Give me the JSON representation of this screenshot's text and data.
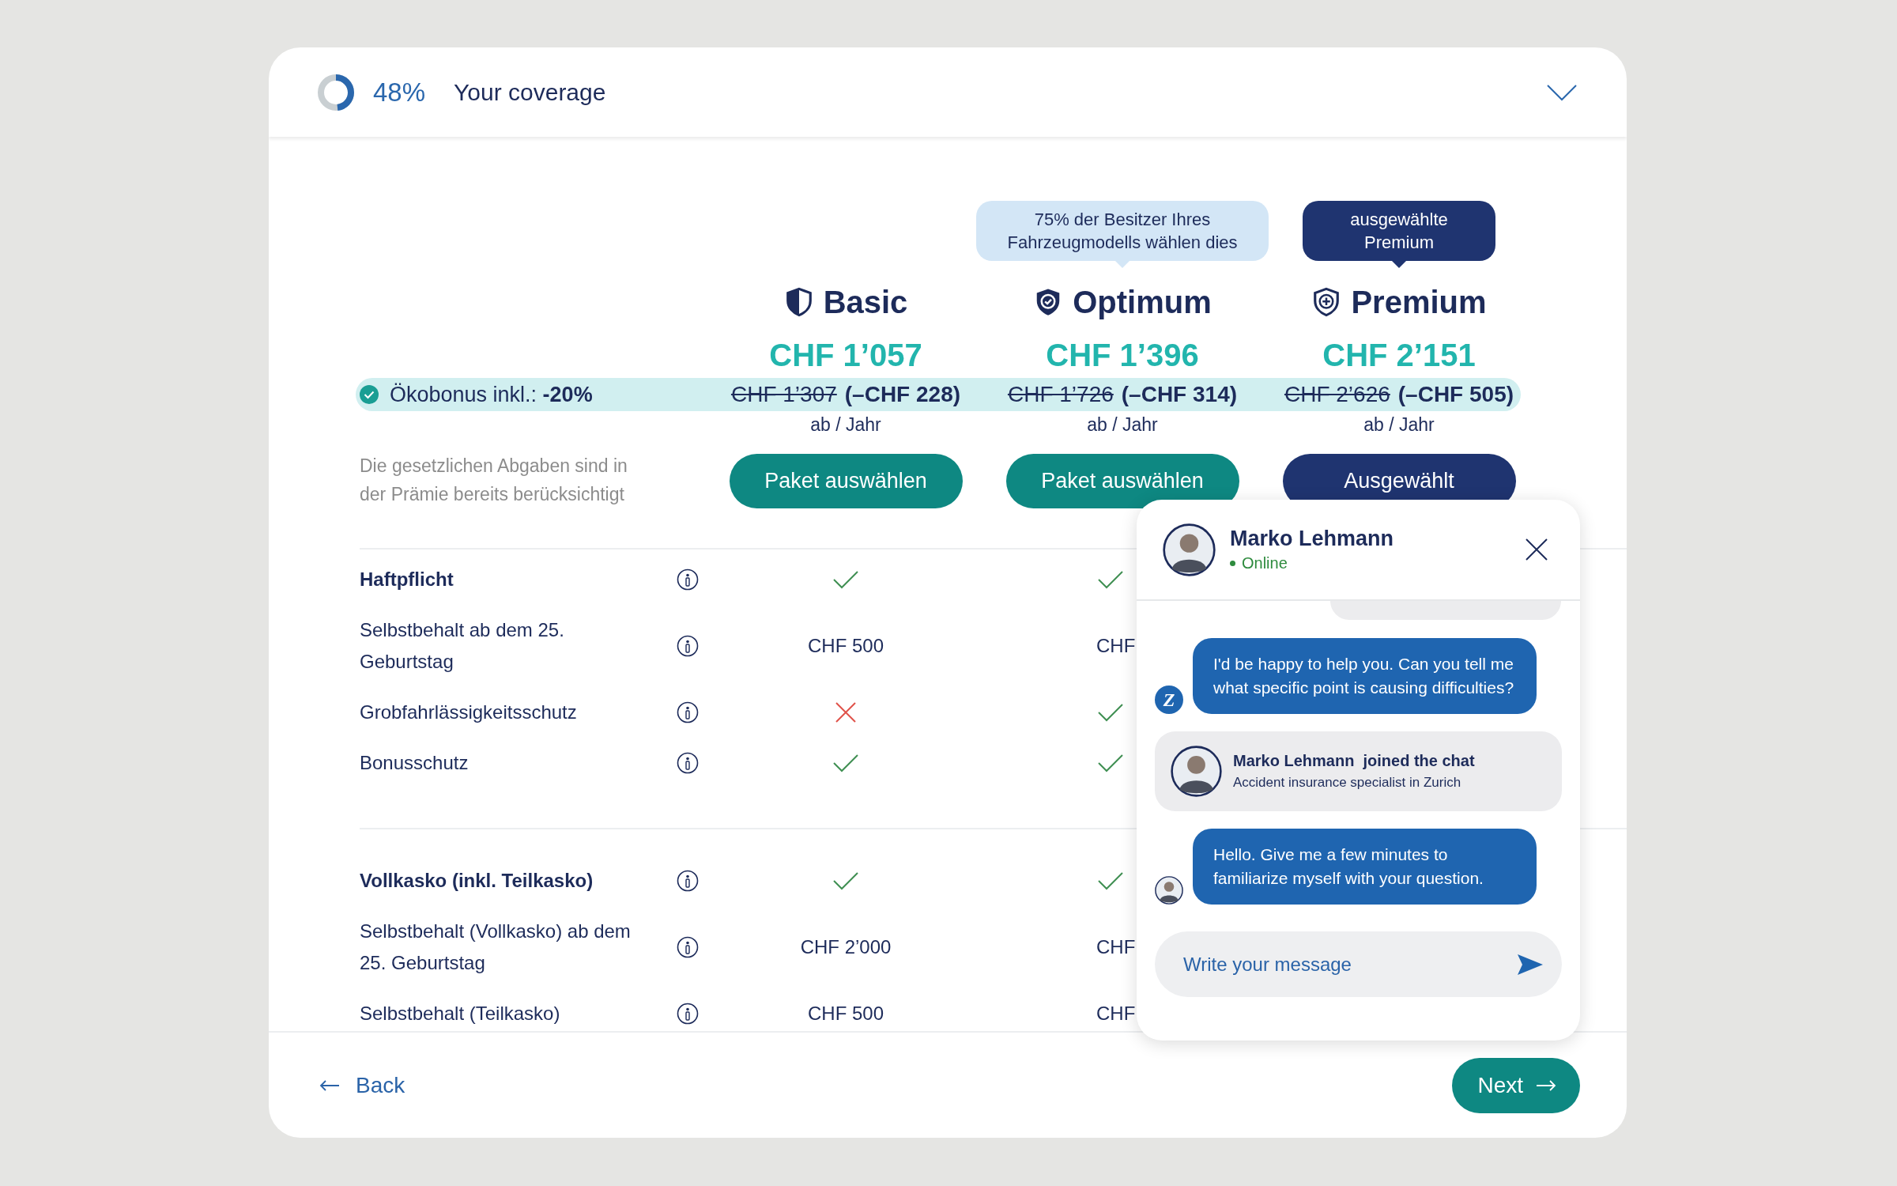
{
  "header": {
    "progress_label": "48%",
    "level": 0.48,
    "title": "Your coverage"
  },
  "plans": [
    {
      "name": "Basic",
      "kind": "half",
      "price": "CHF 1’057",
      "old_price": "CHF 1’307",
      "discount": "(–CHF 228)",
      "period": "ab / Jahr",
      "button": "Paket auswählen",
      "selected": false
    },
    {
      "name": "Optimum",
      "kind": "check",
      "badge": {
        "kind": "recommendation",
        "text": "75% der Besitzer Ihres Fahrzeugmodells wählen dies"
      },
      "price": "CHF 1’396",
      "old_price": "CHF 1’726",
      "discount": "(–CHF 314)",
      "period": "ab / Jahr",
      "button": "Paket auswählen",
      "selected": false
    },
    {
      "name": "Premium",
      "kind": "plus",
      "badge": {
        "kind": "chosen",
        "text": "ausgewählte Premium"
      },
      "price": "CHF 2’151",
      "old_price": "CHF 2’626",
      "discount": "(–CHF 505)",
      "period": "ab / Jahr",
      "button": "Ausgewählt",
      "selected": true
    }
  ],
  "ecobonus": {
    "label": "Ökobonus inkl.: **-20%**"
  },
  "tax_note": "Die gesetzlichen Abgaben sind in der Prämie bereits berücksichtigt",
  "sections": [
    {
      "rows": [
        {
          "kind": "heading",
          "label": "Haftpflicht",
          "values": [
            {
              "kind": "check"
            },
            {
              "kind": "check"
            }
          ]
        },
        {
          "kind": "item",
          "label": "Selbstbehalt ab dem 25. Geburtstag",
          "values": [
            {
              "kind": "text",
              "text": "CHF 500"
            },
            {
              "kind": "text",
              "text": "CHF"
            }
          ]
        },
        {
          "kind": "item",
          "label": "Grobfahrlässigkeitsschutz",
          "values": [
            {
              "kind": "cross"
            },
            {
              "kind": "check"
            }
          ]
        },
        {
          "kind": "item",
          "label": "Bonusschutz",
          "values": [
            {
              "kind": "check"
            },
            {
              "kind": "check"
            }
          ]
        }
      ]
    },
    {
      "rows": [
        {
          "kind": "heading",
          "label": "Vollkasko (inkl. Teilkasko)",
          "values": [
            {
              "kind": "check"
            },
            {
              "kind": "check"
            }
          ]
        },
        {
          "kind": "item",
          "label": "Selbstbehalt (Vollkasko) ab dem 25. Geburtstag",
          "values": [
            {
              "kind": "text",
              "text": "CHF 2’000"
            },
            {
              "kind": "text",
              "text": "CHF"
            }
          ]
        },
        {
          "kind": "item",
          "label": "Selbstbehalt (Teilkasko)",
          "values": [
            {
              "kind": "text",
              "text": "CHF 500"
            },
            {
              "kind": "text",
              "text": "CHF"
            }
          ]
        }
      ]
    }
  ],
  "chat": {
    "agent": {
      "name": "Marko Lehmann",
      "status": "Online",
      "online": true
    },
    "bot_logo": "Z",
    "messages": [
      {
        "kind": "partial"
      },
      {
        "kind": "bot",
        "text": "I'd be happy to help you. Can you tell me what specific point is causing difficulties?"
      },
      {
        "kind": "join",
        "name": "Marko Lehmann",
        "action": "joined the chat",
        "role": "Accident insurance specialist in Zurich"
      },
      {
        "kind": "agent",
        "text": "Hello. Give me a few minutes to familiarize myself with your question."
      }
    ],
    "input": {
      "placeholder": "Write your message"
    }
  },
  "footer": {
    "back": "Back",
    "next": "Next"
  }
}
